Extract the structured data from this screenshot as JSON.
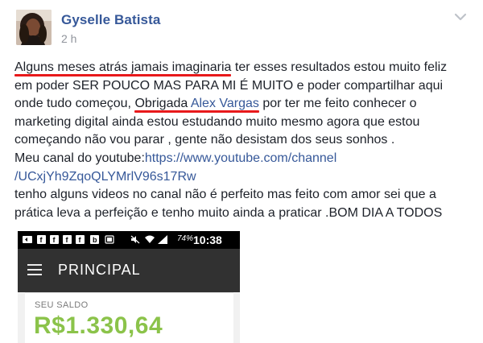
{
  "post": {
    "author": "Gyselle Batista",
    "time": "2 h",
    "lines": {
      "l1_a": "Alguns meses atrás jamais imaginaria",
      "l1_b": " ter esses resultados estou muito feliz",
      "l2": "em poder SER POUCO MAS PARA MI É MUITO e poder compartilhar aqui",
      "l3_a": "onde tudo começou, ",
      "l3_b": "Obrigada ",
      "l3_link": "Alex Vargas",
      "l3_c": " por ter me feito conhecer o",
      "l4": "marketing digital ainda estou estudando muito mesmo agora que estou",
      "l5": "começando não vou parar , gente não desistam dos seus sonhos .",
      "l6_a": "Meu canal do youtube:",
      "l6_link": "https://www.youtube.com/channel",
      "l7_link": "/UCxjYh9ZqoQLYMrlV96s17Rw",
      "l8": "tenho alguns videos no canal não é perfeito mas feito com amor sei que a",
      "l9": "prática leva a perfeição e tenho muito ainda a praticar .BOM DIA A TODOS"
    }
  },
  "phone": {
    "status_battery": "74%",
    "status_time": "10:38 AM",
    "app_title": "PRINCIPAL",
    "saldo_label": "SEU SALDO",
    "saldo_value": "R$1.330,64"
  },
  "colors": {
    "link": "#365899",
    "underline": "#e8191b",
    "saldo": "#8bc34a",
    "appbar": "#313131"
  },
  "icons": [
    "avatar",
    "chevron-down-icon",
    "menu-icon",
    "notification-icons",
    "wifi-icon",
    "signal-icon",
    "battery-icon"
  ]
}
